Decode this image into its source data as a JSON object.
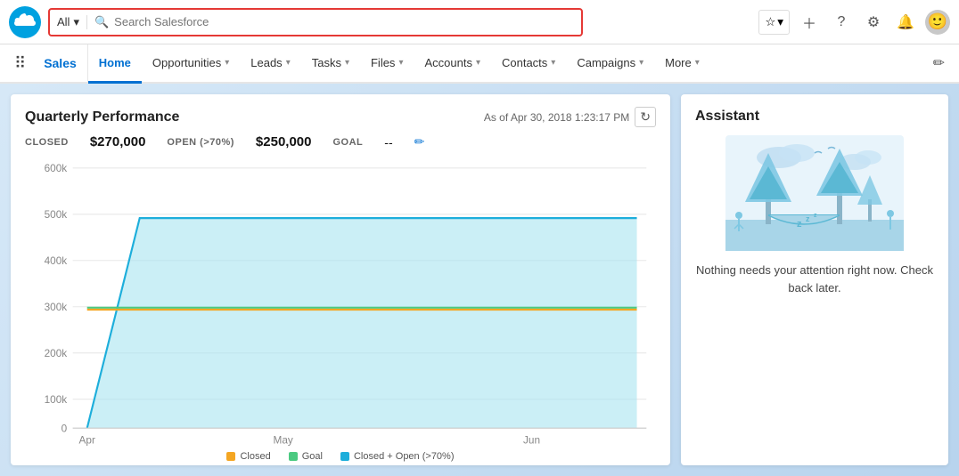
{
  "topbar": {
    "search_all_label": "All",
    "search_placeholder": "Search Salesforce"
  },
  "nav": {
    "app_name": "Sales",
    "items": [
      {
        "label": "Home",
        "active": true,
        "has_chevron": false
      },
      {
        "label": "Opportunities",
        "active": false,
        "has_chevron": true
      },
      {
        "label": "Leads",
        "active": false,
        "has_chevron": true
      },
      {
        "label": "Tasks",
        "active": false,
        "has_chevron": true
      },
      {
        "label": "Files",
        "active": false,
        "has_chevron": true
      },
      {
        "label": "Accounts",
        "active": false,
        "has_chevron": true
      },
      {
        "label": "Contacts",
        "active": false,
        "has_chevron": true
      },
      {
        "label": "Campaigns",
        "active": false,
        "has_chevron": true
      },
      {
        "label": "More",
        "active": false,
        "has_chevron": true
      }
    ]
  },
  "chart": {
    "title": "Quarterly Performance",
    "timestamp": "As of Apr 30, 2018 1:23:17 PM",
    "closed_label": "CLOSED",
    "closed_value": "$270,000",
    "open_label": "OPEN (>70%)",
    "open_value": "$250,000",
    "goal_label": "GOAL",
    "goal_value": "--",
    "y_labels": [
      "600k",
      "500k",
      "400k",
      "300k",
      "200k",
      "100k",
      "0"
    ],
    "x_labels": [
      "Apr",
      "May",
      "Jun"
    ]
  },
  "legend": {
    "items": [
      {
        "label": "Closed",
        "color": "#f4a623"
      },
      {
        "label": "Goal",
        "color": "#4bca81"
      },
      {
        "label": "Closed + Open (>70%)",
        "color": "#1daedb"
      }
    ]
  },
  "assistant": {
    "title": "Assistant",
    "message": "Nothing needs your attention right now. Check back later."
  }
}
